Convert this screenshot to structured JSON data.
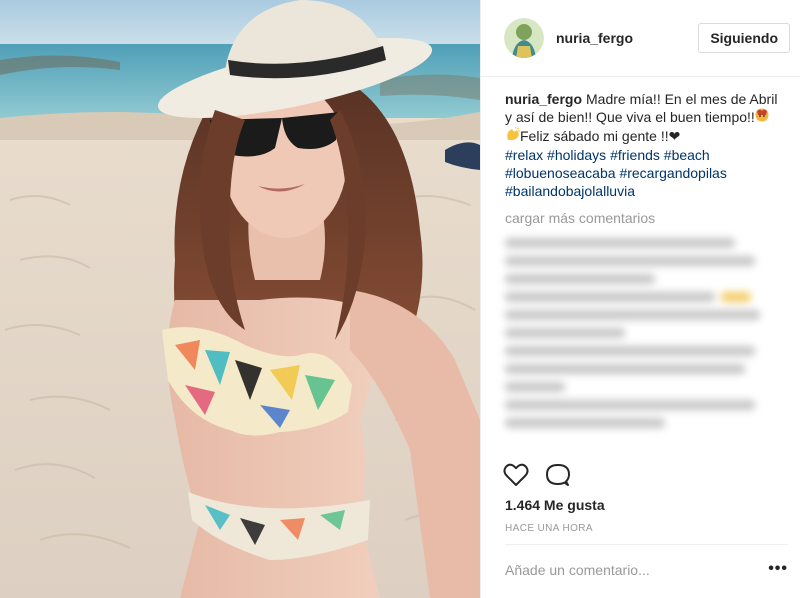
{
  "post": {
    "username": "nuria_fergo",
    "follow_label": "Siguiendo",
    "caption": {
      "username": "nuria_fergo",
      "text_1": "Madre mía!! En el mes de Abril y así de bien!! Que viva el buen tiempo!!",
      "text_2": "Feliz sábado mi gente !!",
      "heart": "❤",
      "hashtags": [
        "#relax",
        "#holidays",
        "#friends",
        "#beach",
        "#lobuenoseacaba",
        "#recargandopilas",
        "#bailandobajolalluvia"
      ]
    },
    "load_more_label": "cargar más comentarios",
    "likes_text": "1.464 Me gusta",
    "timestamp": "HACE UNA HORA",
    "comment_placeholder": "Añade un comentario...",
    "more_options": "•••"
  },
  "icons": {
    "like": "heart-outline-icon",
    "comment": "comment-bubble-icon",
    "more": "more-options-icon"
  },
  "colors": {
    "text": "#262626",
    "hashtag": "#003569",
    "muted": "#999999",
    "border": "#efefef"
  }
}
